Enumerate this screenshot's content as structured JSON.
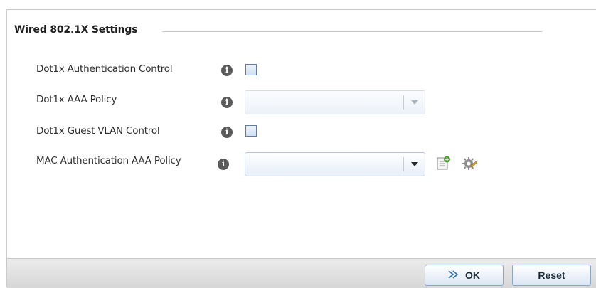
{
  "section": {
    "title": "Wired 802.1X Settings"
  },
  "rows": [
    {
      "label": "Dot1x Authentication Control",
      "control": "checkbox",
      "checked": false
    },
    {
      "label": "Dot1x AAA Policy",
      "control": "select",
      "value": "",
      "disabled": true
    },
    {
      "label": "Dot1x Guest VLAN Control",
      "control": "checkbox",
      "checked": false
    },
    {
      "label": "MAC Authentication AAA Policy",
      "control": "select",
      "value": "",
      "disabled": false
    }
  ],
  "icons": {
    "info": "info-icon",
    "create": "create-policy-icon",
    "edit": "edit-policy-icon",
    "ok": "double-chevron-right-icon"
  },
  "footer": {
    "ok_label": "OK",
    "reset_label": "Reset"
  },
  "colors": {
    "accent": "#2f6fb5",
    "info_icon": "#5b5b5b",
    "checkbox_border": "#5e7ba8"
  }
}
